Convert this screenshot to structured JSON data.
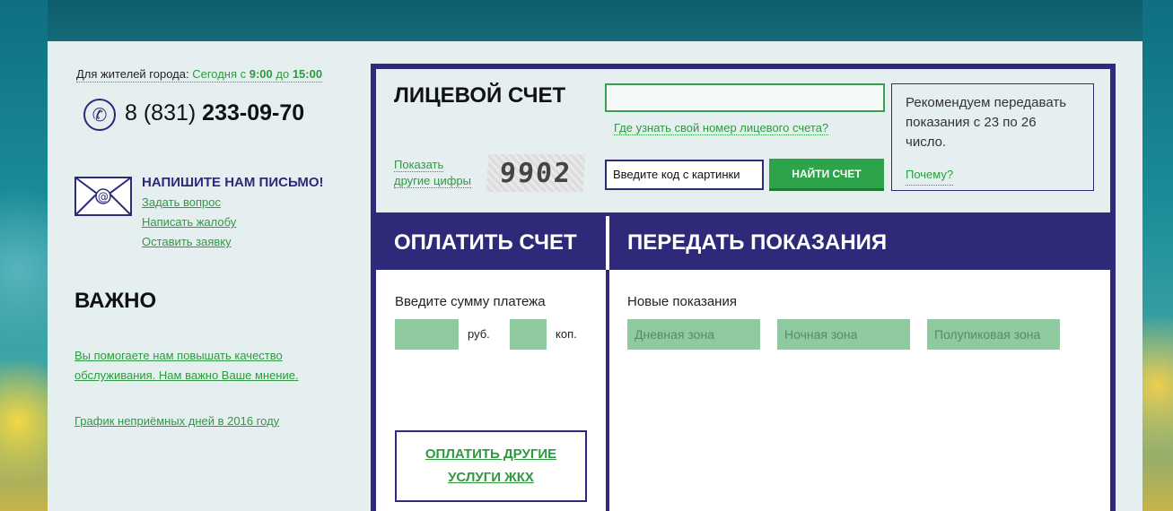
{
  "contact": {
    "hours_prefix": "Для жителей города: ",
    "hours_today": "Сегодня с ",
    "hours_from": "9:00",
    "hours_to_word": " до ",
    "hours_to": "15:00",
    "phone_prefix": "8 (831) ",
    "phone_number": "233-09-70"
  },
  "write": {
    "title": "НАПИШИТЕ НАМ ПИСЬМО!",
    "links": [
      "Задать вопрос",
      "Написать жалобу",
      "Оставить заявку"
    ]
  },
  "important": {
    "title": "ВАЖНО",
    "link1": "Вы помогаете нам повышать качество обслуживания. Нам важно Ваше мнение.",
    "link2": "График неприёмных дней в 2016 году"
  },
  "account": {
    "title": "ЛИЦЕВОЙ СЧЕТ",
    "account_value": "",
    "where_link": "Где узнать свой номер лицевого счета?",
    "show_digits_line1": "Показать",
    "show_digits_line2": "другие цифры",
    "captcha_text": "9902",
    "captcha_placeholder": "Введите код с картинки",
    "find_button": "НАЙТИ СЧЕТ",
    "recommend_text": "Рекомендуем передавать показания с 23 по 26 число.",
    "why_link": "Почему?"
  },
  "pay": {
    "title": "ОПЛАТИТЬ СЧЕТ",
    "amount_label": "Введите сумму платежа",
    "rub_label": "руб.",
    "kop_label": "коп.",
    "other_button": "ОПЛАТИТЬ ДРУГИЕ УСЛУГИ ЖКХ"
  },
  "readings": {
    "title": "ПЕРЕДАТЬ ПОКАЗАНИЯ",
    "new_label": "Новые показания",
    "zones": [
      "Дневная зона",
      "Ночная зона",
      "Полупиковая зона"
    ]
  },
  "colors": {
    "brand_navy": "#2e2a79",
    "accent_green": "#2ea44a",
    "field_green": "#8ec9a0"
  }
}
